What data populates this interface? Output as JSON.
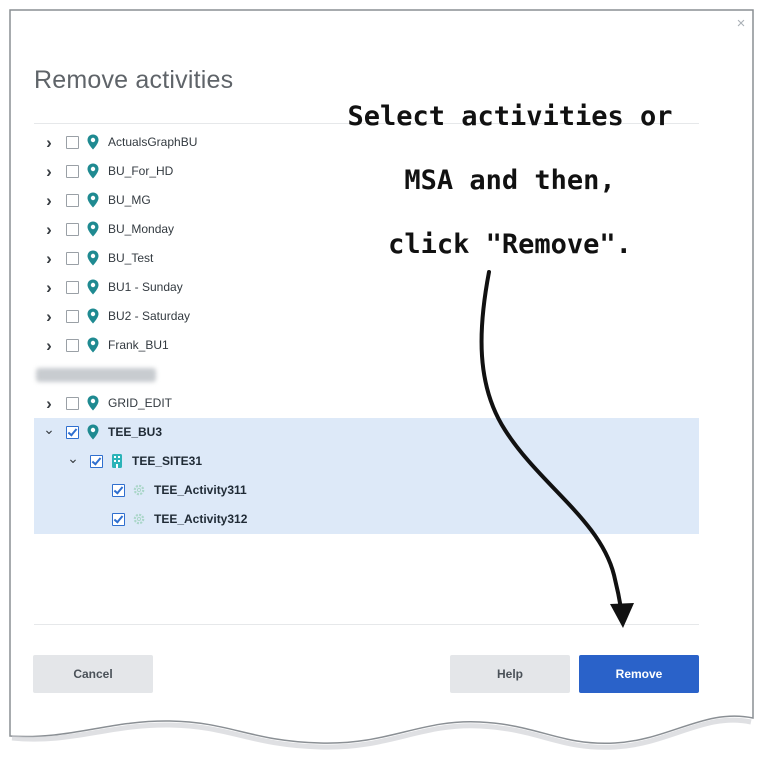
{
  "dialog": {
    "title": "Remove activities",
    "close_icon": "close-icon",
    "close_glyph": "×"
  },
  "tree": {
    "items": [
      {
        "label": "ActualsGraphBU",
        "icon": "location-pin-icon",
        "checked": false,
        "expanded": false
      },
      {
        "label": "BU_For_HD",
        "icon": "location-pin-icon",
        "checked": false,
        "expanded": false
      },
      {
        "label": "BU_MG",
        "icon": "location-pin-icon",
        "checked": false,
        "expanded": false
      },
      {
        "label": "BU_Monday",
        "icon": "location-pin-icon",
        "checked": false,
        "expanded": false
      },
      {
        "label": "BU_Test",
        "icon": "location-pin-icon",
        "checked": false,
        "expanded": false
      },
      {
        "label": "BU1 - Sunday",
        "icon": "location-pin-icon",
        "checked": false,
        "expanded": false
      },
      {
        "label": "BU2 - Saturday",
        "icon": "location-pin-icon",
        "checked": false,
        "expanded": false
      },
      {
        "label": "Frank_BU1",
        "icon": "location-pin-icon",
        "checked": false,
        "expanded": false
      },
      {
        "label": "",
        "blurred": true
      },
      {
        "label": "GRID_EDIT",
        "icon": "location-pin-icon",
        "checked": false,
        "expanded": false
      },
      {
        "label": "TEE_BU3",
        "icon": "location-pin-icon",
        "checked": true,
        "expanded": true
      },
      {
        "label": "TEE_SITE31",
        "icon": "site-building-icon",
        "checked": true,
        "expanded": true
      },
      {
        "label": "TEE_Activity311",
        "icon": "activity-gear-icon",
        "checked": true
      },
      {
        "label": "TEE_Activity312",
        "icon": "activity-gear-icon",
        "checked": true
      }
    ]
  },
  "footer": {
    "cancel_label": "Cancel",
    "help_label": "Help",
    "remove_label": "Remove"
  },
  "annotation": {
    "line1": "Select activities or",
    "line2": "MSA and then,",
    "line3": "click \"Remove\"."
  },
  "colors": {
    "accent": "#2a62c9",
    "selected_row": "#dde9f8",
    "pin": "#1f8a91",
    "site": "#2bb3b8"
  }
}
